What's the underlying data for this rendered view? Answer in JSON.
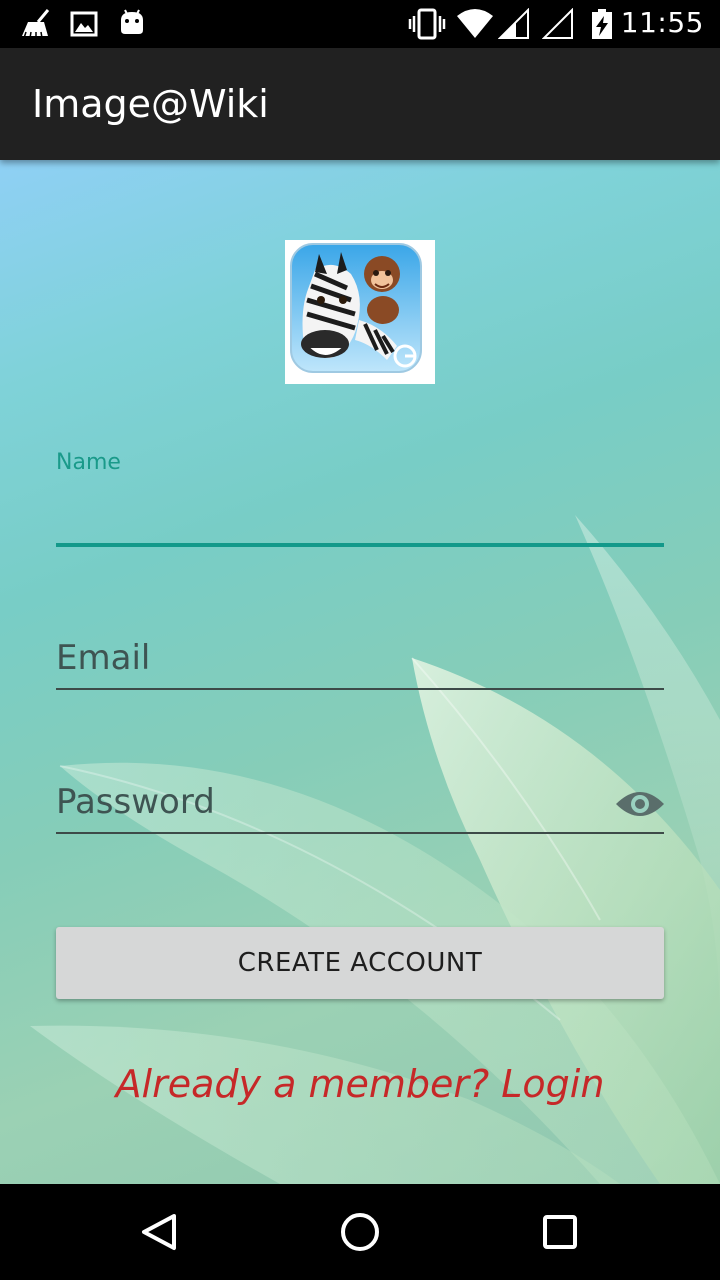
{
  "status_bar": {
    "time": "11:55",
    "icons": [
      "cleaner-icon",
      "gallery-icon",
      "android-icon",
      "vibrate-icon",
      "wifi-icon",
      "signal-icon",
      "signal-empty-icon",
      "battery-charging-icon"
    ]
  },
  "app_bar": {
    "title": "Image@Wiki"
  },
  "form": {
    "logo_icon": "zebra-monkey-app-logo",
    "name_label": "Name",
    "name_value": "",
    "email_placeholder": "Email",
    "password_placeholder": "Password",
    "password_toggle_icon": "eye-icon",
    "create_button_label": "CREATE ACCOUNT",
    "login_link": "Already a member? Login"
  },
  "nav_bar": {
    "icons": [
      "back-icon",
      "home-icon",
      "recents-icon"
    ]
  },
  "colors": {
    "accent": "#13998a",
    "link": "#c62828",
    "app_bar": "#212121",
    "button": "#d6d7d7"
  }
}
